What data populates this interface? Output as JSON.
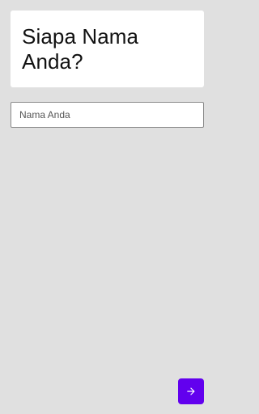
{
  "question": {
    "title": "Siapa Nama Anda?"
  },
  "name_input": {
    "placeholder": "Nama Anda",
    "value": ""
  },
  "next_button": {
    "icon": "arrow-right-icon",
    "color": "#6200ee"
  },
  "colors": {
    "background": "#e0e0e0",
    "card": "#ffffff",
    "accent": "#6200ee"
  }
}
